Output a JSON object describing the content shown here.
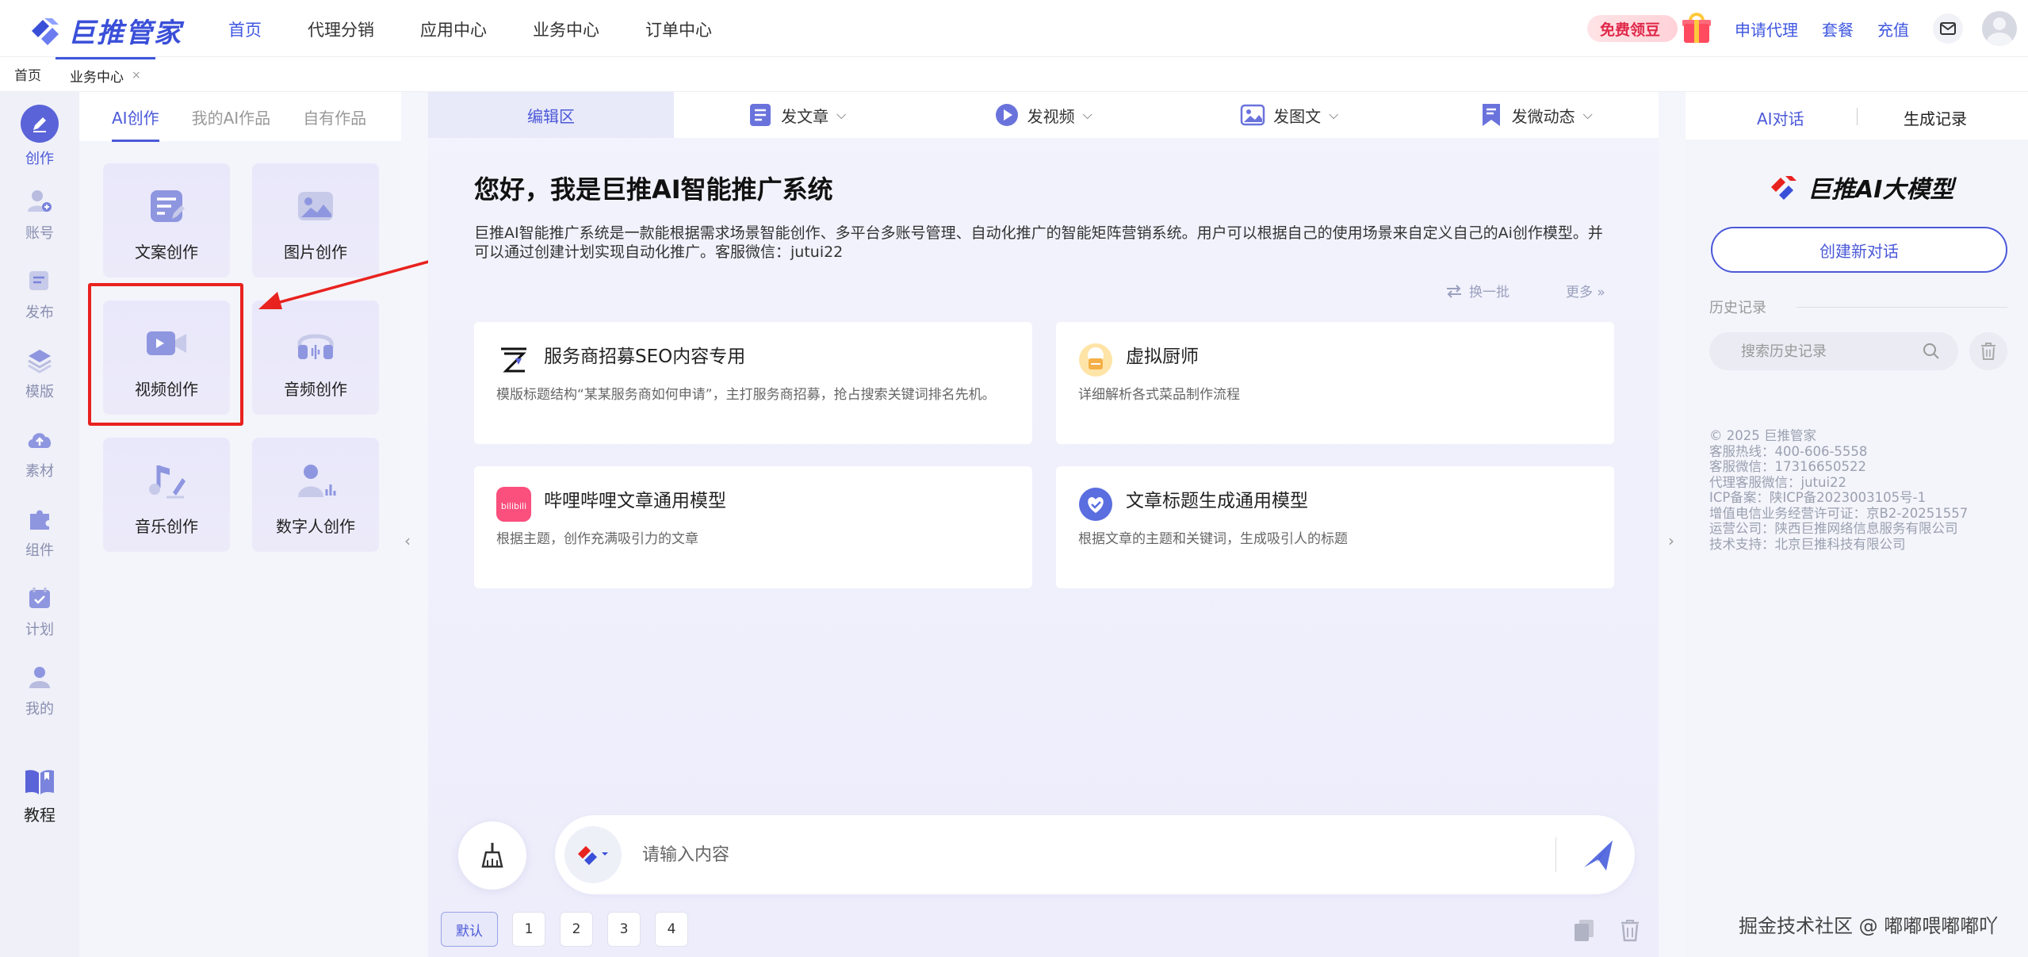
{
  "brand": {
    "name": "巨推管家"
  },
  "topnav": {
    "links": [
      "首页",
      "代理分销",
      "应用中心",
      "业务中心",
      "订单中心"
    ],
    "free_pill": "免费领豆",
    "apply_agent": "申请代理",
    "package": "套餐",
    "recharge": "充值"
  },
  "tabstrip": {
    "tabs": [
      "首页",
      "业务中心"
    ],
    "close": "×"
  },
  "rail": {
    "items": [
      "创作",
      "账号",
      "发布",
      "模版",
      "素材",
      "组件",
      "计划",
      "我的"
    ],
    "tutorial": "教程"
  },
  "panel_left": {
    "subtabs": [
      "AI创作",
      "我的AI作品",
      "自有作品"
    ],
    "cards": [
      "文案创作",
      "图片创作",
      "视频创作",
      "音频创作",
      "音乐创作",
      "数字人创作"
    ]
  },
  "center": {
    "tabs": [
      {
        "label": "编辑区"
      },
      {
        "label": "发文章",
        "chev": "⌵"
      },
      {
        "label": "发视频",
        "chev": "⌵"
      },
      {
        "label": "发图文",
        "chev": "⌵"
      },
      {
        "label": "发微动态",
        "chev": "⌵"
      }
    ],
    "greeting_title": "您好，我是巨推AI智能推广系统",
    "greeting_desc": "巨推AI智能推广系统是一款能根据需求场景智能创作、多平台多账号管理、自动化推广的智能矩阵营销系统。用户可以根据自己的使用场景来自定义自己的Ai创作模型。并可以通过创建计划实现自动化推广。客服微信：jutui22",
    "refresh": "换一批",
    "more": "更多 »",
    "models": [
      {
        "title": "服务商招募SEO内容专用",
        "desc": "模版标题结构“某某服务商如何申请”，主打服务商招募，抢占搜索关键词排名先机。"
      },
      {
        "title": "虚拟厨师",
        "desc": "详细解析各式菜品制作流程"
      },
      {
        "title": "哔哩哔哩文章通用模型",
        "desc": "根据主题，创作充满吸引力的文章",
        "icon_text": "bilibili"
      },
      {
        "title": "文章标题生成通用模型",
        "desc": "根据文章的主题和关键词，生成吸引人的标题"
      }
    ],
    "input_placeholder": "请输入内容",
    "pager": [
      "默认",
      "1",
      "2",
      "3",
      "4"
    ],
    "collapse_left": "‹",
    "collapse_right": "›"
  },
  "right": {
    "tabs": [
      "AI对话",
      "生成记录"
    ],
    "logo_text": "巨推AI大模型",
    "new_chat": "创建新对话",
    "history_label": "历史记录",
    "search_placeholder": "搜索历史记录",
    "footer": [
      "© 2025 巨推管家",
      "客服热线：400-606-5558",
      "客服微信：17316650522",
      "代理客服微信：jutui22",
      "ICP备案：陕ICP备2023003105号-1",
      "增值电信业务经营许可证：京B2-20251557",
      "运营公司：陕西巨推网络信息服务有限公司",
      "技术支持：北京巨推科技有限公司"
    ]
  },
  "watermark": "掘金技术社区 @ 嘟嘟喂嘟嘟吖",
  "colors": {
    "accent": "#4b59d8",
    "highlight": "#e8221f"
  }
}
